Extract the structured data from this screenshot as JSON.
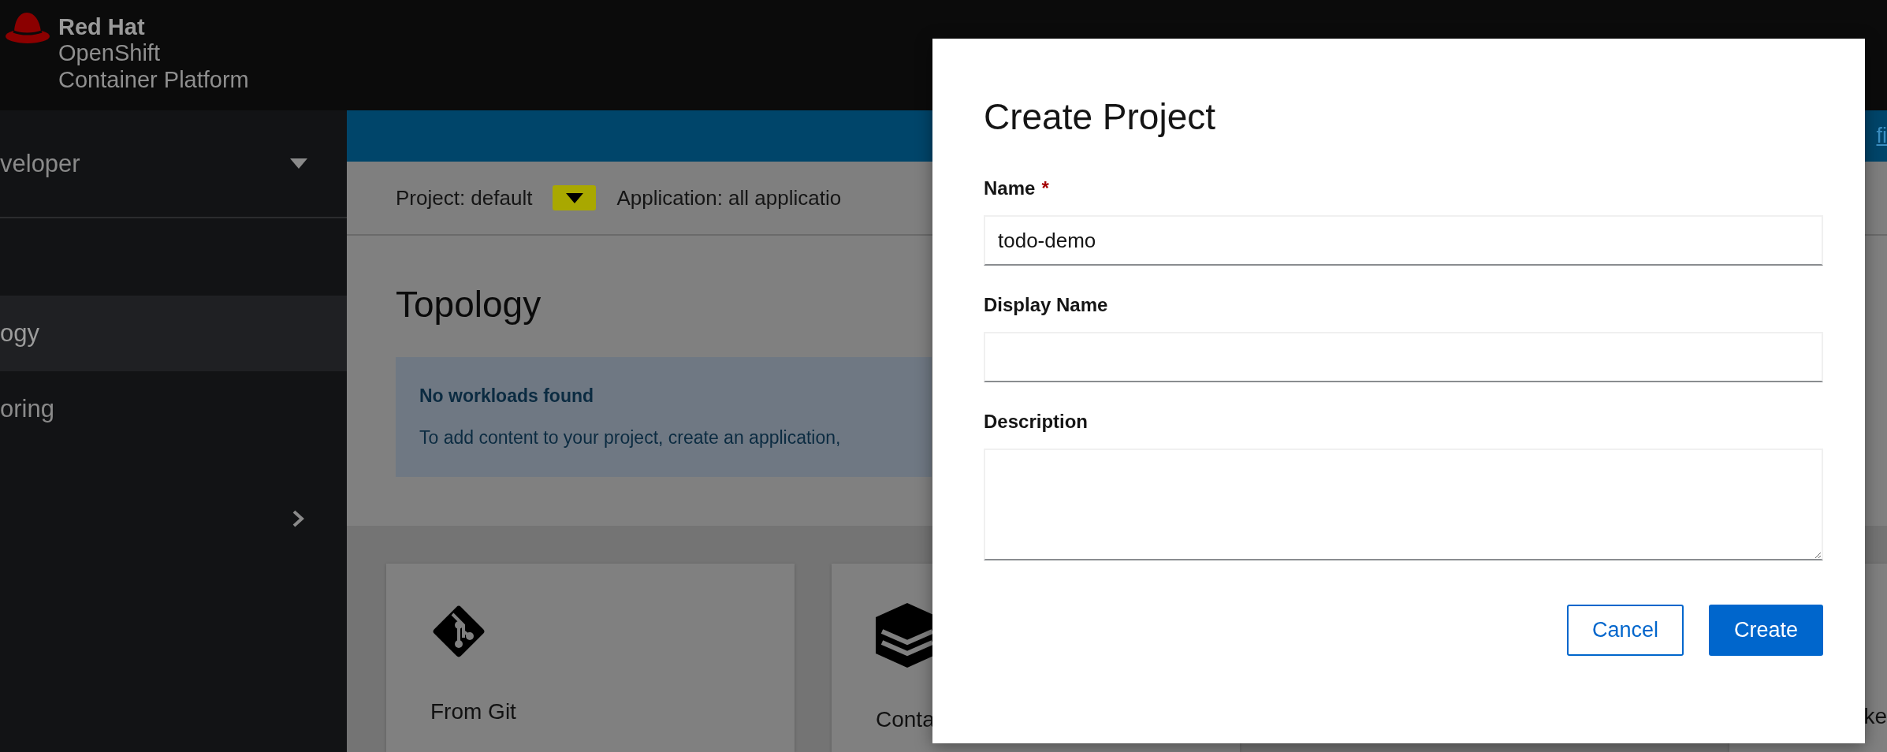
{
  "masthead": {
    "brand": "Red Hat",
    "product": "OpenShift",
    "subtitle": "Container Platform"
  },
  "sidebar": {
    "perspective": "veloper",
    "items": [
      {
        "label": "ogy",
        "selected": true
      },
      {
        "label": "oring",
        "selected": false
      }
    ],
    "collapsed_group": {
      "expanded": false
    }
  },
  "banner": {
    "link": "fi"
  },
  "project_bar": {
    "project": "Project: default",
    "highlighted": true,
    "application": "Application: all applicatio"
  },
  "page": {
    "title": "Topology",
    "alert": {
      "title": "No workloads found",
      "body": "To add content to your project, create an application,"
    },
    "cards": [
      {
        "kind": "git",
        "label": "From Git"
      },
      {
        "kind": "container",
        "label": "Conta"
      },
      {
        "kind": "other",
        "label": "ke"
      }
    ]
  },
  "modal": {
    "title": "Create Project",
    "required_mark": "*",
    "fields": [
      {
        "kind": "text",
        "label": "Name",
        "required": true,
        "value": "todo-demo"
      },
      {
        "kind": "text",
        "label": "Display Name",
        "required": false
      },
      {
        "kind": "textarea",
        "label": "Description",
        "required": false
      }
    ],
    "buttons": [
      {
        "kind": "secondary",
        "label": "Cancel"
      },
      {
        "kind": "primary",
        "label": "Create"
      }
    ]
  }
}
